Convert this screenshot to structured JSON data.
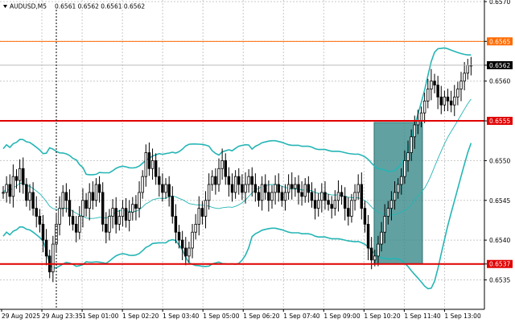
{
  "chart_data": {
    "type": "candlestick",
    "header": {
      "symbol_label": "AUDUSD,M5",
      "ohlc_text": "0.6561 0.6562 0.6561 0.6562"
    },
    "y_range": [
      0.65313,
      0.65702
    ],
    "y_ticks": [
      "0.6570",
      "0.6565",
      "0.6562",
      "0.6560",
      "0.6555",
      "0.6550",
      "0.6545",
      "0.6540",
      "0.6537",
      "0.6535"
    ],
    "x_ticks": [
      "29 Aug 2025",
      "29 Aug 23:35",
      "1 Sep 01:00",
      "1 Sep 02:20",
      "1 Sep 03:40",
      "1 Sep 05:00",
      "1 Sep 06:20",
      "1 Sep 07:40",
      "1 Sep 09:00",
      "1 Sep 10:20",
      "1 Sep 11:40",
      "1 Sep 13:00"
    ],
    "levels": {
      "orange": 0.6565,
      "current": 0.6562,
      "red_upper": 0.6555,
      "red_lower": 0.6537
    },
    "colors": {
      "orange": "#ff6a00",
      "red": "#e00000",
      "band": "#26b5b5",
      "box": "#3a8a8a",
      "candle": "#000000",
      "grid": "#c8c8c8"
    },
    "highlight_box": {
      "x_start": 0.7265,
      "x_end": 0.8203,
      "y_high": 0.65548,
      "y_low": 0.6537
    },
    "closes": [
      0.6546,
      0.6547,
      0.65455,
      0.6548,
      0.65475,
      0.6549,
      0.6547,
      0.6545,
      0.6546,
      0.6544,
      0.6543,
      0.6542,
      0.654,
      0.6538,
      0.6536,
      0.65395,
      0.6542,
      0.6544,
      0.6546,
      0.6545,
      0.6543,
      0.6542,
      0.6541,
      0.6543,
      0.6545,
      0.6544,
      0.6546,
      0.6545,
      0.6547,
      0.6546,
      0.6542,
      0.6541,
      0.6543,
      0.6544,
      0.6542,
      0.6543,
      0.6544,
      0.65425,
      0.65435,
      0.65445,
      0.6544,
      0.6546,
      0.6548,
      0.6551,
      0.6549,
      0.655,
      0.6548,
      0.6547,
      0.6546,
      0.6547,
      0.65455,
      0.6543,
      0.6541,
      0.654,
      0.6539,
      0.6538,
      0.6539,
      0.6541,
      0.6542,
      0.6544,
      0.6543,
      0.6545,
      0.6547,
      0.6548,
      0.6547,
      0.6549,
      0.655,
      0.6548,
      0.6547,
      0.6546,
      0.6548,
      0.6547,
      0.6546,
      0.6547,
      0.6548,
      0.6547,
      0.6546,
      0.6545,
      0.6547,
      0.6546,
      0.6545,
      0.6546,
      0.6547,
      0.6546,
      0.6545,
      0.6546,
      0.6547,
      0.65465,
      0.6547,
      0.6546,
      0.65455,
      0.6547,
      0.6546,
      0.6545,
      0.6544,
      0.6545,
      0.6546,
      0.6545,
      0.65445,
      0.6544,
      0.6545,
      0.6546,
      0.65455,
      0.6544,
      0.6543,
      0.6545,
      0.6546,
      0.6547,
      0.6544,
      0.6542,
      0.6539,
      0.65375,
      0.6538,
      0.65395,
      0.6541,
      0.6543,
      0.6544,
      0.6545,
      0.6546,
      0.6547,
      0.6548,
      0.655,
      0.6551,
      0.6553,
      0.65545,
      0.6555,
      0.6556,
      0.65575,
      0.6559,
      0.656,
      0.65595,
      0.6558,
      0.6557,
      0.6558,
      0.65575,
      0.6557,
      0.6558,
      0.6559,
      0.656,
      0.6561,
      0.6562,
      0.6562
    ]
  }
}
